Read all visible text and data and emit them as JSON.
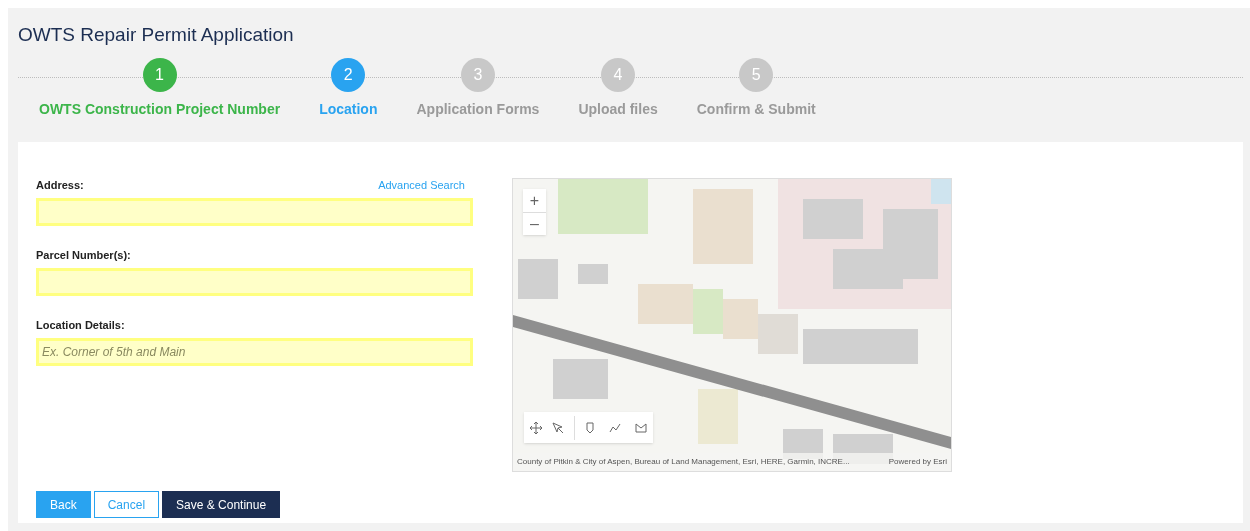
{
  "title": "OWTS Repair Permit Application",
  "steps": [
    {
      "number": "1",
      "label": "OWTS Construction Project Number",
      "kind": "complete"
    },
    {
      "number": "2",
      "label": "Location",
      "kind": "current"
    },
    {
      "number": "3",
      "label": "Application Forms",
      "kind": "upcoming"
    },
    {
      "number": "4",
      "label": "Upload files",
      "kind": "upcoming"
    },
    {
      "number": "5",
      "label": "Confirm & Submit",
      "kind": "upcoming"
    }
  ],
  "form": {
    "advanced_search": "Advanced Search",
    "fields": [
      {
        "label": "Address:"
      },
      {
        "label": "Parcel Number(s):"
      },
      {
        "label": "Location Details:",
        "placeholder": "Ex. Corner of 5th and Main"
      }
    ]
  },
  "map": {
    "zoom_in": "+",
    "zoom_out": "–",
    "attribution": "County of Pitkin & City of Aspen, Bureau of Land Management, Esri, HERE, Garmin, INCRE...",
    "powered_by": "Powered by Esri"
  },
  "buttons": [
    {
      "label": "Back",
      "kind": "secondary"
    },
    {
      "label": "Cancel",
      "kind": "outline"
    },
    {
      "label": "Save & Continue",
      "kind": "primary"
    }
  ]
}
